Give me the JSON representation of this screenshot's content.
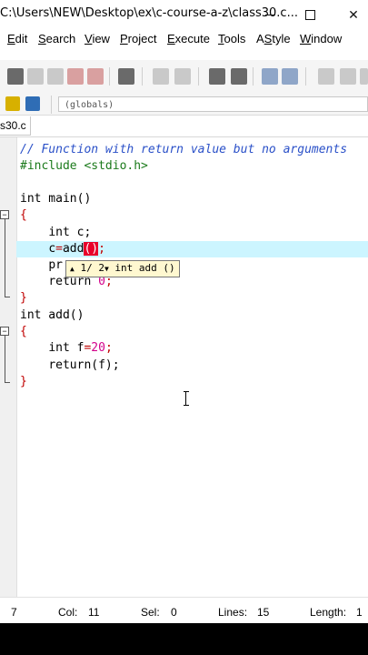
{
  "window": {
    "title": "C:\\Users\\NEW\\Desktop\\ex\\c-course-a-z\\class30.c...",
    "controls": {
      "minimize": "",
      "maximize": "",
      "close": "✕"
    }
  },
  "menu": [
    {
      "pre": "",
      "u": "E",
      "post": "dit"
    },
    {
      "pre": "",
      "u": "S",
      "post": "earch"
    },
    {
      "pre": "",
      "u": "V",
      "post": "iew"
    },
    {
      "pre": "",
      "u": "P",
      "post": "roject"
    },
    {
      "pre": "",
      "u": "E",
      "post": "xecute"
    },
    {
      "pre": "",
      "u": "T",
      "post": "ools"
    },
    {
      "pre": "A",
      "u": "S",
      "post": "tyle"
    },
    {
      "pre": "",
      "u": "W",
      "post": "indow"
    }
  ],
  "toolbar2": {
    "scope": "(globals)"
  },
  "file_tab": {
    "label": "s30.c"
  },
  "code": {
    "comment": "// Function with return value but no arguments",
    "include": "#include <stdio.h>",
    "main_sig": "int main()",
    "open_brace": "{",
    "decl_kw": "int",
    "decl_rest": " c;",
    "assign_c": "c",
    "assign_eq": "=",
    "assign_fn": "add",
    "assign_open": "(",
    "assign_close": ")",
    "assign_semi": ";",
    "print_partial": "pr",
    "return_kw": "return",
    "return_val": "0",
    "return_semi": ";",
    "close_brace": "}",
    "add_sig": "int add()",
    "f_kw": "int",
    "f_name": " f",
    "f_eq": "=",
    "f_val": "20",
    "f_semi": ";",
    "ret_f": "return(f);"
  },
  "tooltip": {
    "up": "▲",
    "counter": "1/ 2",
    "down": "▼",
    "signature": "int add ()"
  },
  "status": {
    "line_partial": "7",
    "col_label": "Col:",
    "col_value": "11",
    "sel_label": "Sel:",
    "sel_value": "0",
    "lines_label": "Lines:",
    "lines_value": "15",
    "length_label": "Length:",
    "length_value": "1"
  }
}
